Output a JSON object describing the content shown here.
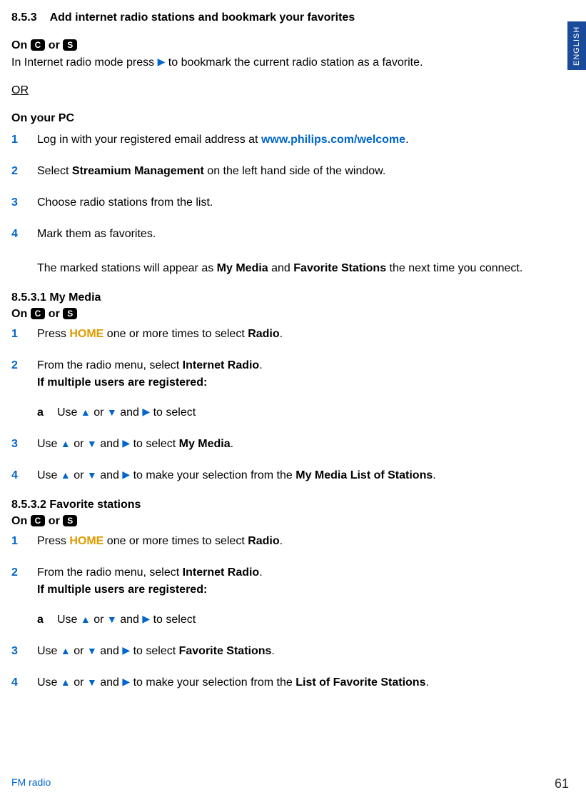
{
  "sideTab": "ENGLISH",
  "section": {
    "num": "8.5.3",
    "title": "Add internet radio stations and bookmark your favorites"
  },
  "topBlock": {
    "on": "On",
    "chipC": "C",
    "or": "or",
    "chipS": "S",
    "line2a": "In Internet radio mode press",
    "line2b": "to bookmark the current radio station as a favorite.",
    "orWord": "OR",
    "onPC": "On your PC"
  },
  "pcSteps": [
    {
      "n": "1",
      "pre": "Log in with your registered email address at ",
      "link": "www.philips.com/welcome",
      "post": "."
    },
    {
      "n": "2",
      "pre": "Select ",
      "b": "Streamium Management",
      "post": " on the left hand side of the window."
    },
    {
      "n": "3",
      "pre": "Choose radio stations from the list."
    },
    {
      "n": "4",
      "pre": "Mark them as favorites.",
      "extra1": "The marked stations will appear as ",
      "b1": "My Media",
      "mid": " and ",
      "b2": "Favorite Stations",
      "extra2": " the next time you connect."
    }
  ],
  "s1": {
    "num": "8.5.3.1",
    "title": "My Media",
    "on": "On",
    "chipC": "C",
    "or": "or",
    "chipS": "S",
    "steps": [
      {
        "n": "1",
        "pre": "Press ",
        "home": "HOME",
        "post": " one or more times to select ",
        "b": "Radio",
        "end": "."
      },
      {
        "n": "2",
        "pre": "From the radio menu, select ",
        "b": "Internet Radio",
        "end": ".",
        "bold2": "If multiple users are registered:",
        "subLetter": "a",
        "subPre": "Use ",
        "subMid": " or ",
        "subAnd": " and ",
        "subEnd": " to select"
      },
      {
        "n": "3",
        "pre": "Use ",
        "mid": " or ",
        "and": " and ",
        "post": " to select ",
        "b": "My Media",
        "end": "."
      },
      {
        "n": "4",
        "pre": "Use ",
        "mid": " or ",
        "and": " and ",
        "post": " to make your selection from the ",
        "b": "My Media List of Stations",
        "end": "."
      }
    ]
  },
  "s2": {
    "num": "8.5.3.2",
    "title": "Favorite stations",
    "on": "On",
    "chipC": "C",
    "or": "or",
    "chipS": "S",
    "steps": [
      {
        "n": "1",
        "pre": "Press ",
        "home": "HOME",
        "post": " one or more times to select ",
        "b": "Radio",
        "end": "."
      },
      {
        "n": "2",
        "pre": "From the radio menu, select ",
        "b": "Internet Radio",
        "end": ".",
        "bold2": "If multiple users are registered:",
        "subLetter": "a",
        "subPre": "Use ",
        "subMid": " or ",
        "subAnd": " and ",
        "subEnd": " to select"
      },
      {
        "n": "3",
        "pre": "Use ",
        "mid": " or ",
        "and": " and ",
        "post": " to select ",
        "b": "Favorite Stations",
        "end": "."
      },
      {
        "n": "4",
        "pre": "Use ",
        "mid": " or ",
        "and": " and ",
        "post": " to make your selection from the ",
        "b": "List of Favorite Stations",
        "end": "."
      }
    ]
  },
  "footer": {
    "left": "FM radio",
    "right": "61"
  }
}
